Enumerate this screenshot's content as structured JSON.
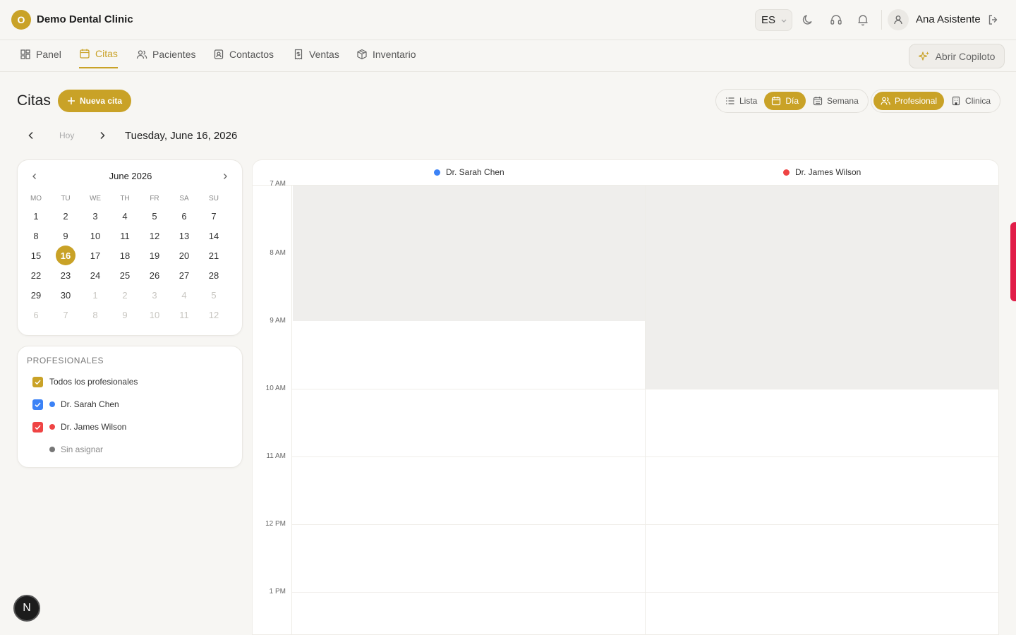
{
  "app": {
    "logo_letter": "O",
    "clinic_name": "Demo Dental Clinic",
    "accent": "#c9a227"
  },
  "header": {
    "language": "ES",
    "user_name": "Ana Asistente"
  },
  "nav": {
    "items": [
      {
        "label": "Panel",
        "icon": "grid-icon"
      },
      {
        "label": "Citas",
        "icon": "calendar-icon",
        "active": true
      },
      {
        "label": "Pacientes",
        "icon": "users-icon"
      },
      {
        "label": "Contactos",
        "icon": "contact-book-icon"
      },
      {
        "label": "Ventas",
        "icon": "receipt-icon"
      },
      {
        "label": "Inventario",
        "icon": "box-icon"
      }
    ],
    "copilot_label": "Abrir Copiloto"
  },
  "page": {
    "title": "Citas",
    "new_button": "Nueva cita",
    "views": {
      "list": "Lista",
      "day": "Día",
      "week": "Semana",
      "active": "Día"
    },
    "groupings": {
      "professional": "Profesional",
      "clinic": "Clinica",
      "active": "Profesional"
    },
    "today": "Hoy",
    "current_date": "Tuesday, June 16, 2026"
  },
  "mini_calendar": {
    "month_label": "June 2026",
    "weekdays": [
      "MO",
      "TU",
      "WE",
      "TH",
      "FR",
      "SA",
      "SU"
    ],
    "selected_day": "16",
    "weeks": [
      [
        "1",
        "2",
        "3",
        "4",
        "5",
        "6",
        "7"
      ],
      [
        "8",
        "9",
        "10",
        "11",
        "12",
        "13",
        "14"
      ],
      [
        "15",
        "16",
        "17",
        "18",
        "19",
        "20",
        "21"
      ],
      [
        "22",
        "23",
        "24",
        "25",
        "26",
        "27",
        "28"
      ],
      [
        "29",
        "30",
        "1",
        "2",
        "3",
        "4",
        "5"
      ],
      [
        "6",
        "7",
        "8",
        "9",
        "10",
        "11",
        "12"
      ]
    ]
  },
  "professionals": {
    "title": "PROFESIONALES",
    "all_label": "Todos los profesionales",
    "list": [
      {
        "name": "Dr. Sarah Chen",
        "color": "#3b82f6",
        "checked": true
      },
      {
        "name": "Dr. James Wilson",
        "color": "#ef4444",
        "checked": true
      }
    ],
    "unassigned": {
      "label": "Sin asignar",
      "color": "#777777"
    }
  },
  "schedule": {
    "columns": [
      {
        "name": "Dr. Sarah Chen",
        "color": "#3b82f6"
      },
      {
        "name": "Dr. James Wilson",
        "color": "#ef4444"
      }
    ],
    "time_labels": [
      "7 AM",
      "8 AM",
      "9 AM",
      "10 AM",
      "11 AM",
      "12 PM",
      "1 PM"
    ]
  },
  "floating_badge": "N"
}
